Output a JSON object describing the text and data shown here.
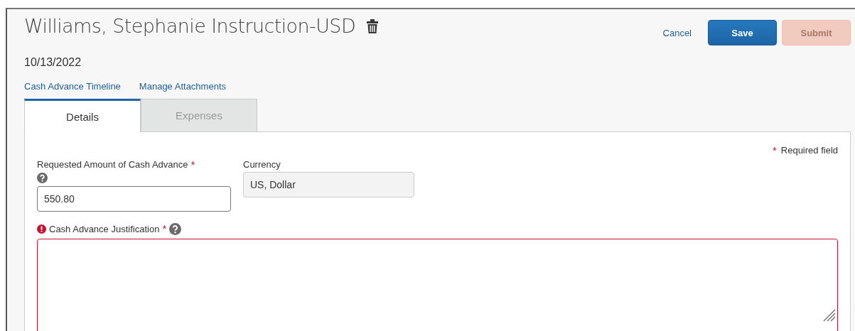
{
  "header": {
    "title": "Williams, Stephanie Instruction-USD",
    "date": "10/13/2022"
  },
  "actions": [
    {
      "kind": "link",
      "label": "Cancel"
    },
    {
      "kind": "primary",
      "label": "Save",
      "disabled": false
    },
    {
      "kind": "primary",
      "label": "Submit",
      "disabled": true
    }
  ],
  "links": [
    "Cash Advance Timeline",
    "Manage Attachments"
  ],
  "tabs": [
    {
      "label": "Details",
      "selected": true
    },
    {
      "label": "Expenses",
      "selected": false
    }
  ],
  "required_legend": {
    "mark": "*",
    "text": "Required field"
  },
  "fields": [
    {
      "kind": "input",
      "label": "Requested Amount of Cash Advance",
      "required_mark": "*",
      "help": true,
      "value": "550.80",
      "readonly": false,
      "error": false
    },
    {
      "kind": "input",
      "label": "Currency",
      "value": "US, Dollar",
      "readonly": true,
      "error": false
    },
    {
      "kind": "textarea",
      "label": "Cash Advance Justification",
      "required_mark": "*",
      "help": true,
      "error": true
    }
  ]
}
